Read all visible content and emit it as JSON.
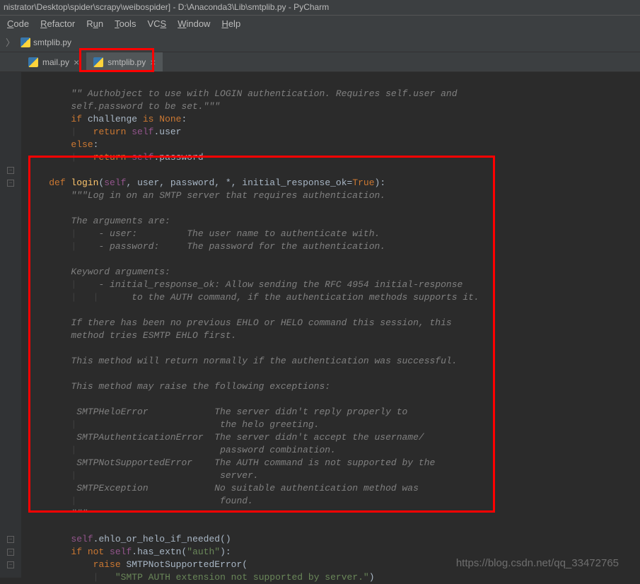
{
  "title": "nistrator\\Desktop\\spider\\scrapy\\weibospider] - D:\\Anaconda3\\Lib\\smtplib.py - PyCharm",
  "menu": {
    "code": "Code",
    "refactor": "Refactor",
    "run": "Run",
    "tools": "Tools",
    "vcs": "VCS",
    "window": "Window",
    "help": "Help"
  },
  "breadcrumb": {
    "file": "smtplib.py"
  },
  "tabs": {
    "mail": "mail.py",
    "smtplib": "smtplib.py"
  },
  "code": {
    "l1_a": "\"\" Authobject to use with LOGIN authentication. Requires self.user and",
    "l2_a": "self.password to be set.\"\"\"",
    "l3_if": "if",
    "l3_var": " challenge ",
    "l3_is": "is",
    "l3_none": " None",
    "l4_return": "return",
    "l4_self": " self",
    "l4_user": ".user",
    "l5_else": "else",
    "l6_return": "return",
    "l6_self": " self",
    "l6_pw": ".password",
    "l8_def": "def",
    "l8_fn": " login",
    "l8_self": "self",
    "l8_params": ", user, password, *, initial_response_ok=",
    "l8_true": "True",
    "l9": "\"\"\"Log in on an SMTP server that requires authentication.",
    "l11": "The arguments are:",
    "l12": "    - user:         The user name to authenticate with.",
    "l13": "    - password:     The password for the authentication.",
    "l15": "Keyword arguments:",
    "l16": "    - initial_response_ok: Allow sending the RFC 4954 initial-response",
    "l17": "      to the AUTH command, if the authentication methods supports it.",
    "l19": "If there has been no previous EHLO or HELO command this session, this",
    "l20": "method tries ESMTP EHLO first.",
    "l22": "This method will return normally if the authentication was successful.",
    "l24": "This method may raise the following exceptions:",
    "l26": " SMTPHeloError            The server didn't reply properly to",
    "l27": "                          the helo greeting.",
    "l28": " SMTPAuthenticationError  The server didn't accept the username/",
    "l29": "                          password combination.",
    "l30": " SMTPNotSupportedError    The AUTH command is not supported by the",
    "l31": "                          server.",
    "l32": " SMTPException            No suitable authentication method was",
    "l33": "                          found.",
    "l34": "\"\"\"",
    "l36_self": "self",
    "l36_call": ".ehlo_or_helo_if_needed()",
    "l37_if": "if",
    "l37_not": " not ",
    "l37_self": "self",
    "l37_has": ".has_extn(",
    "l37_str": "\"auth\"",
    "l38_raise": "raise",
    "l38_err": " SMTPNotSupportedError",
    "l39_str": "\"SMTP AUTH extension not supported by server.\""
  },
  "watermark": "https://blog.csdn.net/qq_33472765"
}
